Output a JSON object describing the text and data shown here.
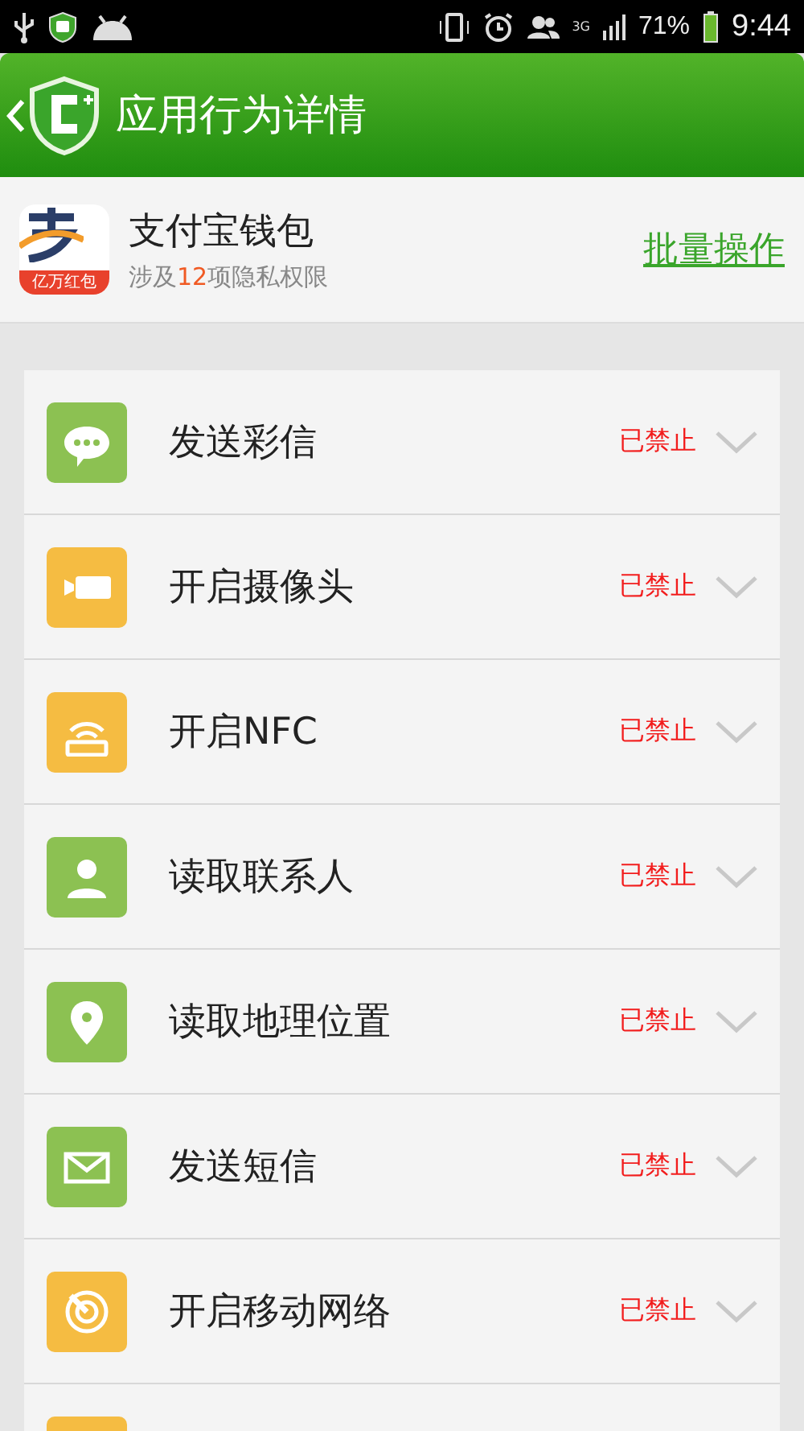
{
  "status_bar": {
    "network": "3G",
    "battery": "71%",
    "time": "9:44"
  },
  "header": {
    "title": "应用行为详情"
  },
  "app": {
    "name": "支付宝钱包",
    "badge": "亿万红包",
    "subtitle": {
      "before": "涉及",
      "count": "12",
      "after": "项隐私权限"
    },
    "action": "批量操作"
  },
  "permissions": [
    {
      "kind": "chat",
      "color": "#8cc152",
      "label": "发送彩信",
      "status": "已禁止"
    },
    {
      "kind": "camera",
      "color": "#f5bc42",
      "label": "开启摄像头",
      "status": "已禁止"
    },
    {
      "kind": "router",
      "color": "#f5bc42",
      "label": "开启NFC",
      "status": "已禁止"
    },
    {
      "kind": "person",
      "color": "#8cc152",
      "label": "读取联系人",
      "status": "已禁止"
    },
    {
      "kind": "pin",
      "color": "#8cc152",
      "label": "读取地理位置",
      "status": "已禁止"
    },
    {
      "kind": "mail",
      "color": "#8cc152",
      "label": "发送短信",
      "status": "已禁止"
    },
    {
      "kind": "radar",
      "color": "#f5bc42",
      "label": "开启移动网络",
      "status": "已禁止"
    },
    {
      "color": "#f5bc42"
    }
  ]
}
